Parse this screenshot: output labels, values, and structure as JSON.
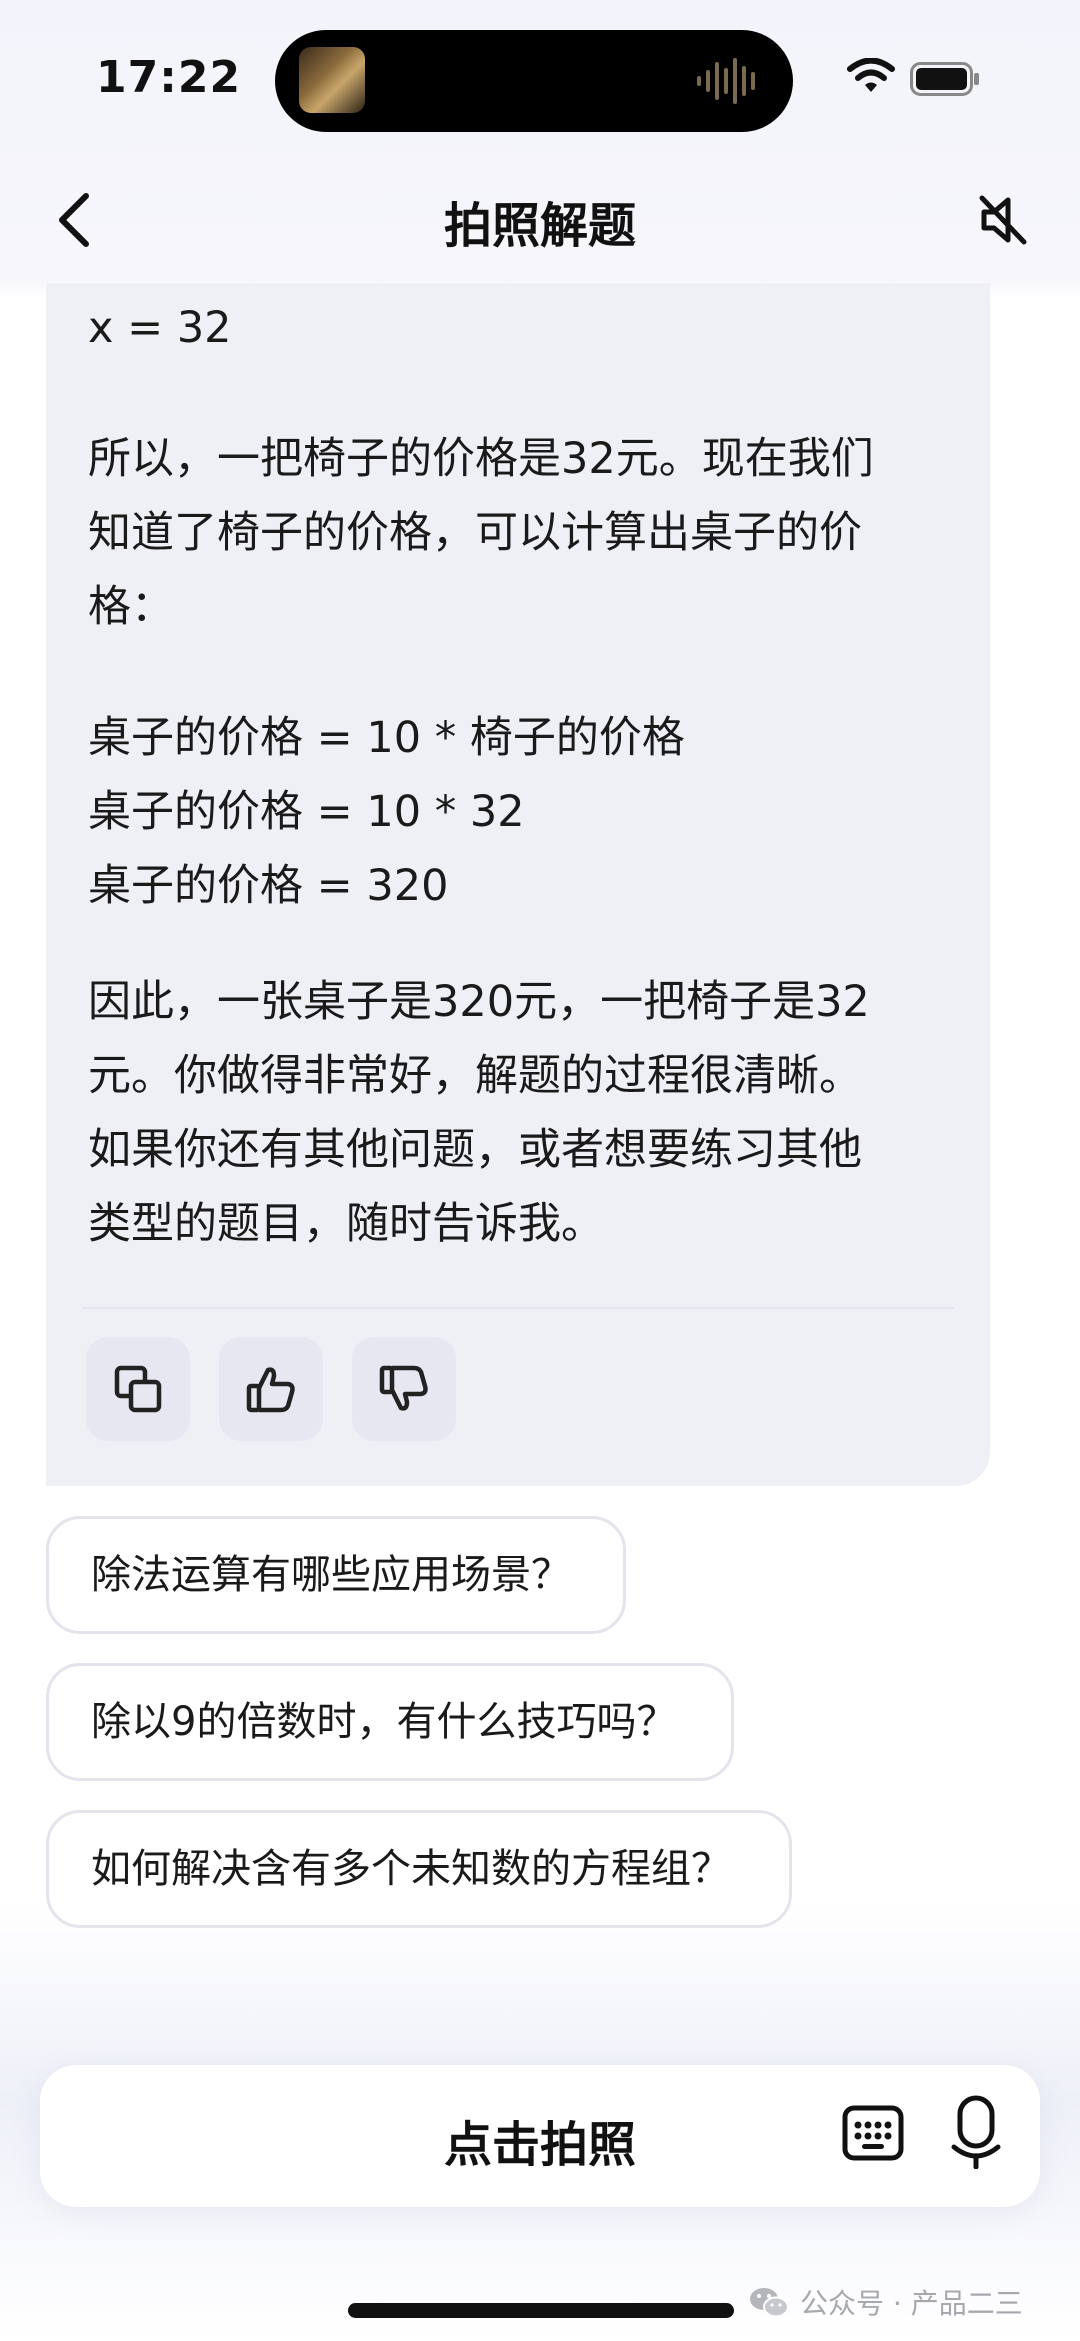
{
  "status_bar": {
    "time": "17:22"
  },
  "nav": {
    "title": "拍照解题"
  },
  "answer": {
    "lines": {
      "l1": "x = 32",
      "l2": "所以，一把椅子的价格是32元。现在我们",
      "l3": "知道了椅子的价格，可以计算出桌子的价",
      "l4": "格：",
      "l5": "桌子的价格 = 10 * 椅子的价格",
      "l6": "桌子的价格 = 10 * 32",
      "l7": "桌子的价格 = 320",
      "l8": "因此，一张桌子是320元，一把椅子是32",
      "l9": "元。你做得非常好，解题的过程很清晰。",
      "l10": "如果你还有其他问题，或者想要练习其他",
      "l11": "类型的题目，随时告诉我。"
    },
    "actions": [
      "copy-icon",
      "thumbs-up-icon",
      "thumbs-down-icon"
    ]
  },
  "suggestions": [
    {
      "label": "除法运算有哪些应用场景？"
    },
    {
      "label": "除以9的倍数时，有什么技巧吗？"
    },
    {
      "label": "如何解决含有多个未知数的方程组？"
    }
  ],
  "input_bar": {
    "label": "点击拍照"
  },
  "watermark": {
    "text": "公众号 · 产品二三"
  },
  "colors": {
    "bubble_bg": "#eff0f6",
    "action_bg": "#e6e7f1",
    "text": "#1a1a1a"
  }
}
